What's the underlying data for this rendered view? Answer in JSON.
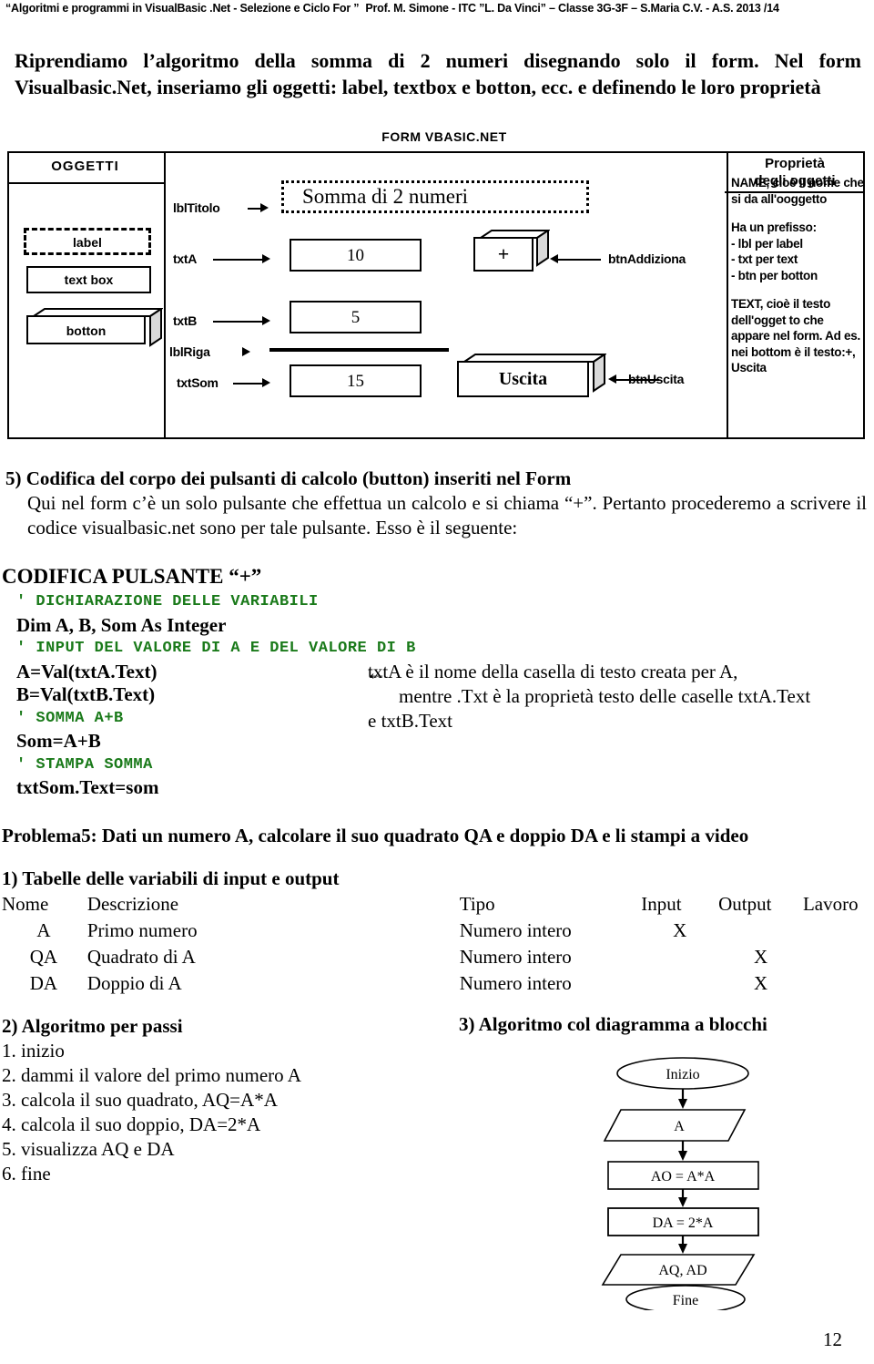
{
  "header": {
    "title_quoted": "“Algoritmi e programmi in VisualBasic .Net - Selezione e Ciclo For ”",
    "author": "Prof.  M. Simone - ITC ”L. Da Vinci” – Classe 3G-3F – S.Maria C.V. - A.S. 2013 /14"
  },
  "intro": {
    "paragraph": "Riprendiamo l’algoritmo della somma di 2 numeri disegnando solo il form. Nel form Visualbasic.Net, inseriamo gli oggetti: label, textbox e botton, ecc. e definendo le loro proprietà"
  },
  "schematic": {
    "form_caption": "FORM VBASIC.NET",
    "objects_header": "OGGETTI",
    "properties_header_line1": "Proprietà",
    "properties_header_line2": "degli oggetti",
    "legend": {
      "label": "label",
      "textbox": "text box",
      "botton": "botton"
    },
    "names": {
      "lblTitolo": "lblTitolo",
      "txtA": "txtA",
      "txtB": "txtB",
      "lblRiga": "lblRiga",
      "txtSom": "txtSom",
      "btnAddiziona": "btnAddiziona",
      "btnUscita": "btnUscita"
    },
    "form": {
      "title_label": "Somma di 2 numeri",
      "txtA_value": "10",
      "txtB_value": "5",
      "txtSom_value": "15",
      "btn_add_text": "+",
      "btn_exit_text": "Uscita"
    },
    "properties_text": [
      "NAME, cioè il nome che si da all'ooggetto",
      "Ha un prefisso:\n- lbl per label\n- txt per text\n- btn per botton",
      "TEXT, cioè il testo dell'ogget to che appare nel form. Ad es. nei bottom è il testo:+, Uscita"
    ]
  },
  "section5": {
    "title": "5) Codifica del corpo dei pulsanti di calcolo (button) inseriti nel Form",
    "body": "Qui nel form c’è un solo pulsante che effettua un calcolo e si chiama “+”. Pertanto procederemo a scrivere il codice visualbasic.net sono per tale pulsante. Esso è il seguente:"
  },
  "code": {
    "title": "CODIFICA PULSANTE “+”",
    "lines": [
      {
        "kind": "comment",
        "text": "' DICHIARAZIONE DELLE VARIABILI"
      },
      {
        "kind": "stmt",
        "text": "Dim A, B, Som As Integer"
      },
      {
        "kind": "comment",
        "text": "' INPUT DEL VALORE DI A E DEL VALORE DI B"
      },
      {
        "kind": "stmt",
        "text": "A=Val(txtA.Text)"
      },
      {
        "kind": "stmt",
        "text": "B=Val(txtB.Text)"
      },
      {
        "kind": "comment",
        "text": "' SOMMA A+B"
      },
      {
        "kind": "stmt",
        "text": "Som=A+B"
      },
      {
        "kind": "comment",
        "text": "' STAMPA SOMMA"
      },
      {
        "kind": "stmt",
        "text": "txtSom.Text=som"
      }
    ],
    "note_arrow": "←",
    "note_line1": "txtA è il nome della casella di testo creata per A,",
    "note_line2": "mentre .Txt è la proprietà testo delle caselle txtA.Text",
    "note_line3": "e txtB.Text"
  },
  "problema5": {
    "title": "Problema5: Dati un numero A, calcolare il suo quadrato QA e doppio DA e li stampi a video",
    "table_title": "1) Tabelle delle variabili di input e output",
    "table": {
      "headers": [
        "Nome",
        "Descrizione",
        "Tipo",
        "Input",
        "Output",
        "Lavoro"
      ],
      "rows": [
        {
          "nome": "A",
          "descrizione": "Primo numero",
          "tipo": "Numero intero",
          "input": "X",
          "output": "",
          "lavoro": ""
        },
        {
          "nome": "QA",
          "descrizione": "Quadrato di A",
          "tipo": "Numero intero",
          "input": "",
          "output": "X",
          "lavoro": ""
        },
        {
          "nome": "DA",
          "descrizione": "Doppio di A",
          "tipo": "Numero intero",
          "input": "",
          "output": "X",
          "lavoro": ""
        }
      ]
    },
    "steps_title": "2) Algoritmo per passi",
    "steps": [
      "1. inizio",
      "2. dammi il valore del primo numero A",
      "3. calcola il suo quadrato, AQ=A*A",
      "4. calcola il suo doppio, DA=2*A",
      "5. visualizza AQ e DA",
      "6. fine"
    ],
    "flow_title": "3) Algoritmo col diagramma a blocchi",
    "flowchart": {
      "nodes": [
        {
          "shape": "ellipse",
          "text": "Inizio"
        },
        {
          "shape": "parallelogram",
          "text": "A"
        },
        {
          "shape": "rect",
          "text": "AO = A*A"
        },
        {
          "shape": "rect",
          "text": "DA = 2*A"
        },
        {
          "shape": "parallelogram",
          "text": "AQ, AD"
        },
        {
          "shape": "ellipse",
          "text": "Fine"
        }
      ]
    }
  },
  "footer": {
    "page_number": "12"
  }
}
